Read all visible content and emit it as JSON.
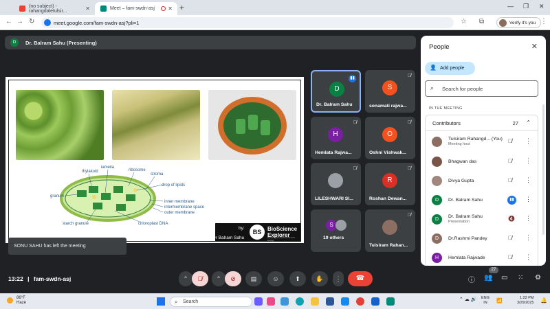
{
  "browser": {
    "tabs": [
      {
        "title": "(no subject) - rahangdaletulsir...",
        "icon": "gmail-icon",
        "color": "#ea4335"
      },
      {
        "title": "Meet – fam-swdn-asj",
        "icon": "meet-icon",
        "color": "#00897b"
      }
    ],
    "url": "meet.google.com/fam-swdn-asj?pli=1",
    "verify_label": "Verify it's you"
  },
  "meeting": {
    "presenter_initial": "D",
    "presenting_label": "Dr. Balram Sahu (Presenting)",
    "toast": "SONU SAHU has left the meeting",
    "time": "13:22",
    "separator": "|",
    "code": "fam-swdn-asj",
    "people_count_badge": "27"
  },
  "slide": {
    "diagram_labels": {
      "thylakoid": "thylakoid",
      "lamella": "lamella",
      "ribosome": "ribosome",
      "stroma": "stroma",
      "drop_of_lipids": "drop of lipids",
      "granum": "granum",
      "inner_membrane": "inner membrane",
      "intermembrane_space": "intermembrane space",
      "outer_membrane": "outer membrane",
      "starch_granule": "starch  granule",
      "chloroplast_dna": "chloroplast DNA"
    },
    "byline": "by:",
    "byname": "Dr Balram Sahu",
    "logo_mark": "BS",
    "logo_title_1": "BioScience",
    "logo_title_2": "Explorer",
    "logo_tagline": "Exploring the world of life and biology"
  },
  "tiles": [
    {
      "name": "Dr. Balram Sahu",
      "initial": "D",
      "color": "#0b8043",
      "speaking": true
    },
    {
      "name": "sonamati rajwa...",
      "initial": "S",
      "color": "#f4511e"
    },
    {
      "name": "Hemlata Rajwa...",
      "initial": "H",
      "color": "#7b1fa2"
    },
    {
      "name": "Oshni Vishwak...",
      "initial": "O",
      "color": "#f4511e"
    },
    {
      "name": "LILESHWARI SI...",
      "initial": "",
      "color": "#9aa0a6"
    },
    {
      "name": "Roshan Dewan...",
      "initial": "R",
      "color": "#d93025"
    },
    {
      "name": "19 others",
      "initial": "S",
      "color": "#7b1fa2"
    },
    {
      "name": "Tulsiram Rahan...",
      "initial": "",
      "color": "#8d6e63"
    }
  ],
  "panel": {
    "title": "People",
    "add_people": "Add people",
    "search_placeholder": "Search for people",
    "section": "IN THE MEETING",
    "contributors_label": "Contributors",
    "contributors_count": "27",
    "participants": [
      {
        "name": "Tulsiram Rahangd...  (You)",
        "sub": "Meeting host",
        "initial": "",
        "color": "#8d6e63",
        "state": "muted"
      },
      {
        "name": "Bhagwan das",
        "sub": "",
        "initial": "",
        "color": "#795548",
        "state": "muted"
      },
      {
        "name": "Divya Gupta",
        "sub": "",
        "initial": "",
        "color": "#a1887f",
        "state": "muted"
      },
      {
        "name": "Dr. Balram Sahu",
        "sub": "",
        "initial": "D",
        "color": "#0b8043",
        "state": "speaking"
      },
      {
        "name": "Dr. Balram Sahu",
        "sub": "Presentation",
        "initial": "D",
        "color": "#0b8043",
        "state": "presenting"
      },
      {
        "name": "Dr.Rashmi Pandey",
        "sub": "",
        "initial": "D",
        "color": "#8d6e63",
        "state": "muted"
      },
      {
        "name": "Hemlata Rajwade",
        "sub": "",
        "initial": "H",
        "color": "#7b1fa2",
        "state": "muted"
      }
    ]
  },
  "taskbar": {
    "temp": "86°F",
    "weather": "Haze",
    "search_label": "Search",
    "lang1": "ENG",
    "lang2": "IN",
    "time": "1:22 PM",
    "date": "3/29/2025"
  }
}
